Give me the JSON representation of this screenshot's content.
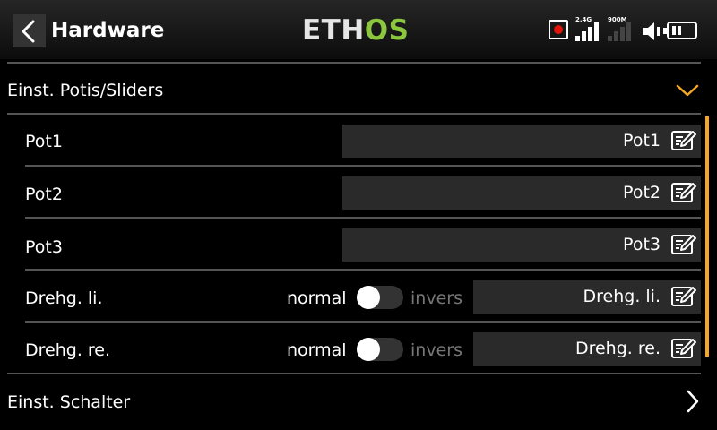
{
  "header": {
    "title": "Hardware",
    "logo_part1": "ETH",
    "logo_part2": "OS",
    "rf_label_1": "2.4G",
    "rf_label_2": "900M",
    "brand_green": "#8cc63f",
    "accent": "#f5a623"
  },
  "sections": {
    "pots_title": "Einst. Potis/Sliders",
    "switches_title": "Einst. Schalter"
  },
  "rows": [
    {
      "label": "Pot1",
      "value": "Pot1"
    },
    {
      "label": "Pot2",
      "value": "Pot2"
    },
    {
      "label": "Pot3",
      "value": "Pot3"
    },
    {
      "label": "Drehg. li.",
      "value": "Drehg. li.",
      "option_left": "normal",
      "option_right": "invers",
      "inverted": false
    },
    {
      "label": "Drehg. re.",
      "value": "Drehg. re.",
      "option_left": "normal",
      "option_right": "invers",
      "inverted": false
    }
  ],
  "icons": [
    "back-arrow-icon",
    "record-icon",
    "signal-bars-icon",
    "speaker-icon",
    "battery-icon",
    "chevron-down-icon",
    "edit-icon",
    "chevron-right-icon"
  ]
}
